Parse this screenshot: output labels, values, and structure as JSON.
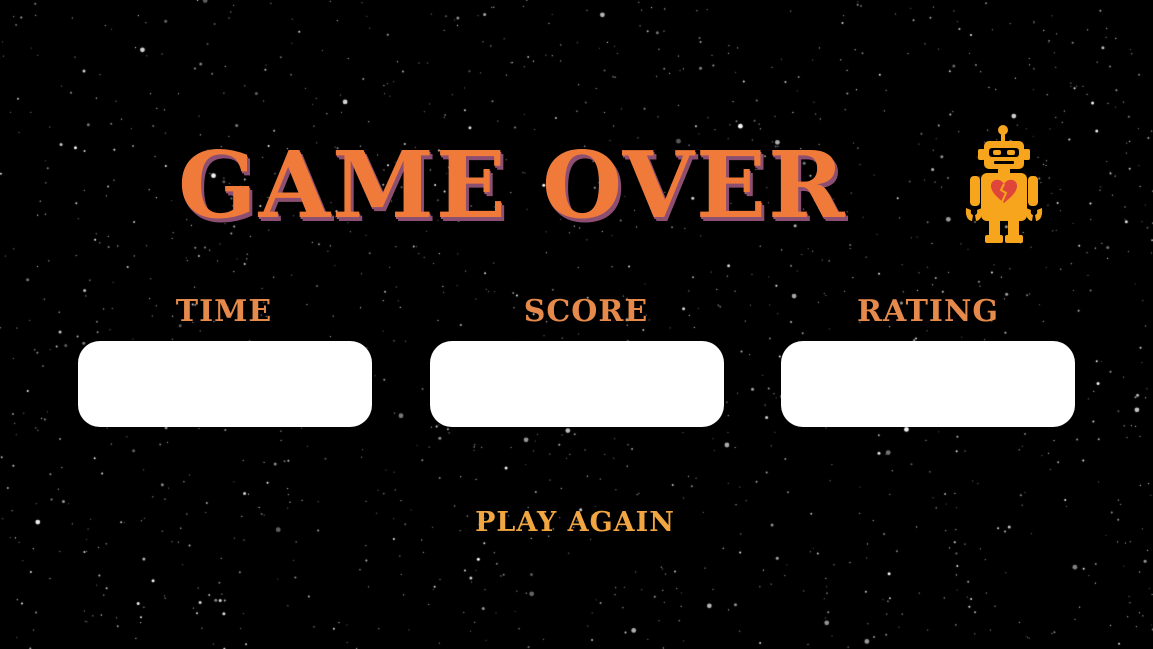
{
  "title": "GAME OVER",
  "robot_icon": "broken-heart-robot",
  "stats": [
    {
      "label": "TIME",
      "value": ""
    },
    {
      "label": "SCORE",
      "value": ""
    },
    {
      "label": "RATING",
      "value": ""
    }
  ],
  "play_again_label": "PLAY AGAIN",
  "colors": {
    "background": "#000000",
    "title": "#f07a3a",
    "title_shadow": "#8c4f72",
    "stat_label": "#e68a4c",
    "stat_box": "#ffffff",
    "play_again": "#f2a641",
    "robot_body": "#f7a51c",
    "robot_heart": "#e0453a"
  }
}
